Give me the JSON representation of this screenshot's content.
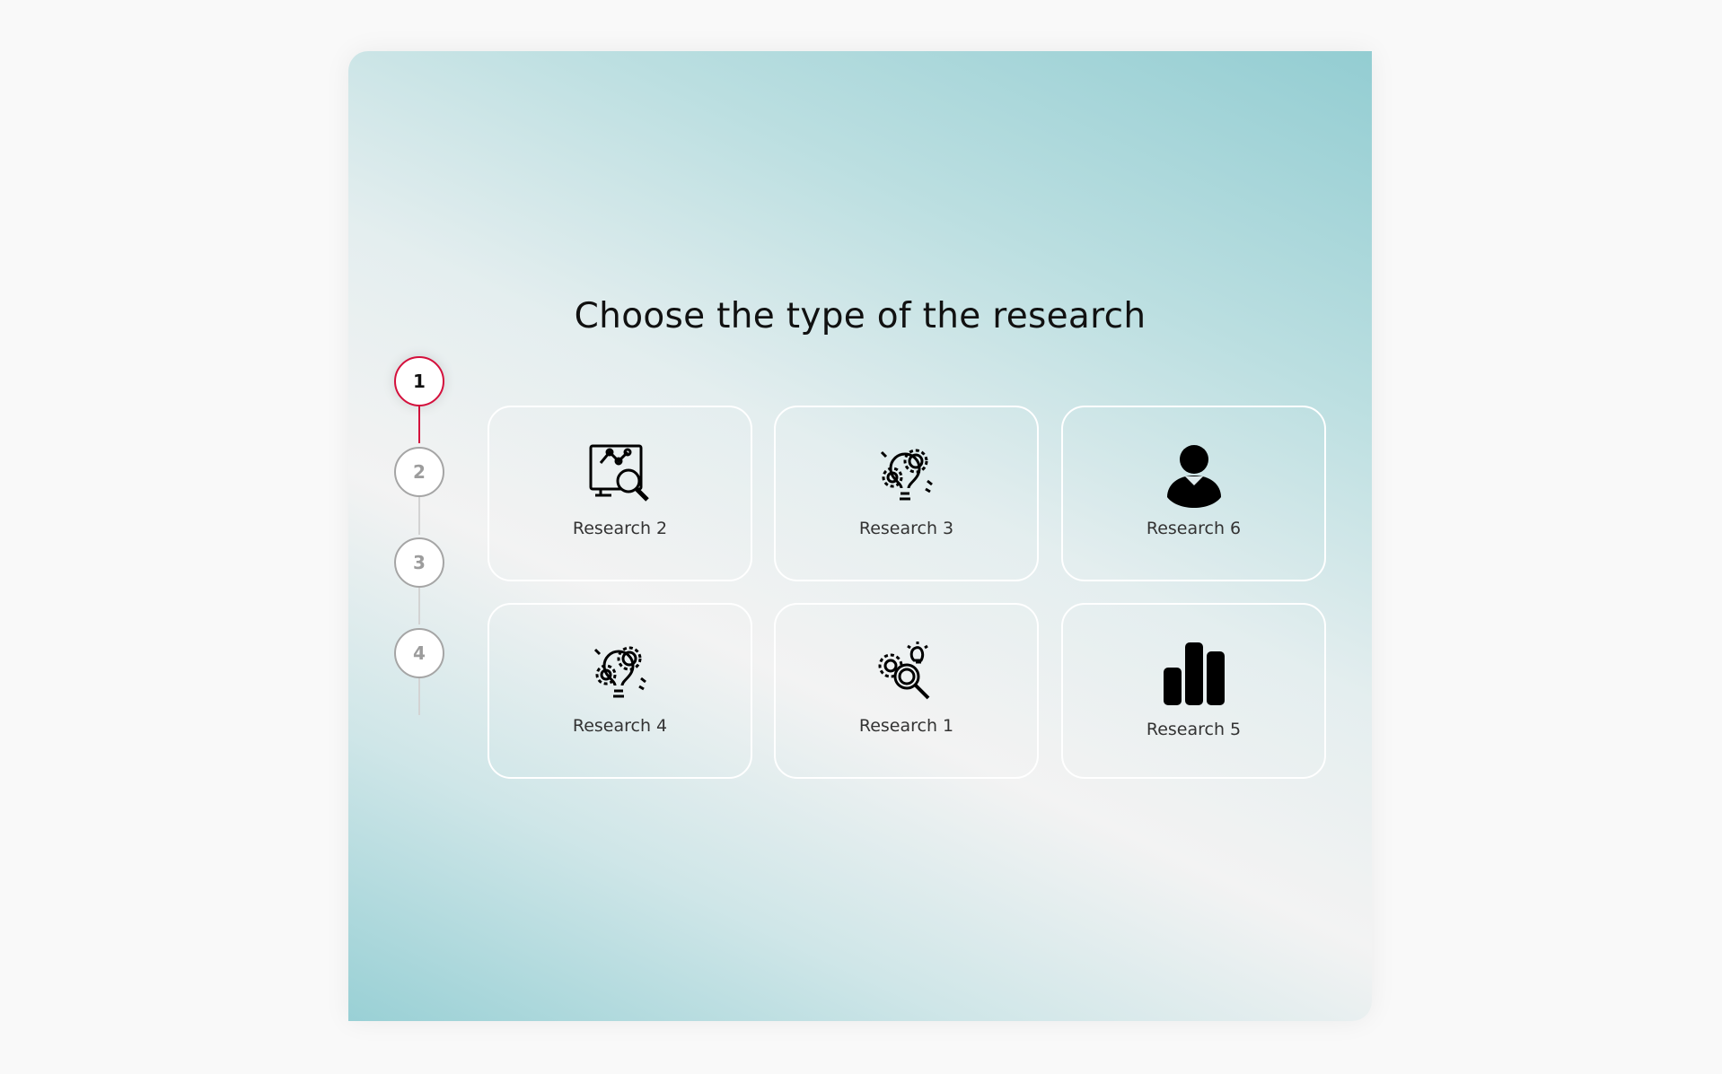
{
  "title": "Choose the type of the research",
  "accent_color": "#d4103c",
  "steps": [
    {
      "label": "1",
      "active": true
    },
    {
      "label": "2",
      "active": false
    },
    {
      "label": "3",
      "active": false
    },
    {
      "label": "4",
      "active": false
    }
  ],
  "options": [
    {
      "label": "Research 2",
      "icon": "monitor-chart-magnifier-icon"
    },
    {
      "label": "Research 3",
      "icon": "lightbulb-gears-icon"
    },
    {
      "label": "Research 6",
      "icon": "user-icon"
    },
    {
      "label": "Research 4",
      "icon": "lightbulb-gears-icon"
    },
    {
      "label": "Research 1",
      "icon": "gears-magnifier-bulb-icon"
    },
    {
      "label": "Research 5",
      "icon": "bar-chart-icon"
    }
  ]
}
